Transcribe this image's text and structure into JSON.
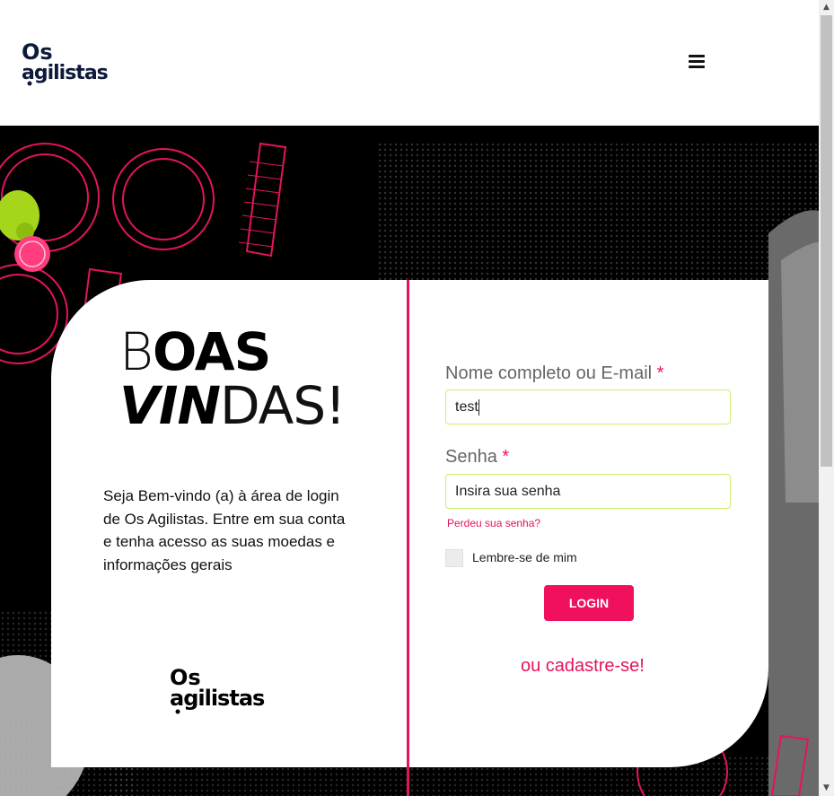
{
  "brand": {
    "logo_line1": "Os",
    "logo_line2": "agilistas",
    "accent": "#e5135f",
    "input_border": "#c8f06a"
  },
  "header": {
    "menu_icon": "hamburger-icon"
  },
  "welcome": {
    "title_line1_thin": "B",
    "title_line1_bold": "OAS",
    "title_line2_bold": "VIN",
    "title_line2_thin": "DAS!",
    "intro_text": "Seja Bem-vindo (a) à área de login de Os Agilistas. Entre em sua conta e tenha acesso as suas moedas e informações gerais"
  },
  "form": {
    "username_label": "Nome completo ou E-mail",
    "username_required": "*",
    "username_value": "test",
    "password_label": "Senha",
    "password_required": "*",
    "password_placeholder": "Insira sua senha",
    "lost_password": "Perdeu sua senha?",
    "remember_label": "Lembre-se de mim",
    "login_button": "LOGIN",
    "signup_link": "ou cadastre-se!"
  }
}
